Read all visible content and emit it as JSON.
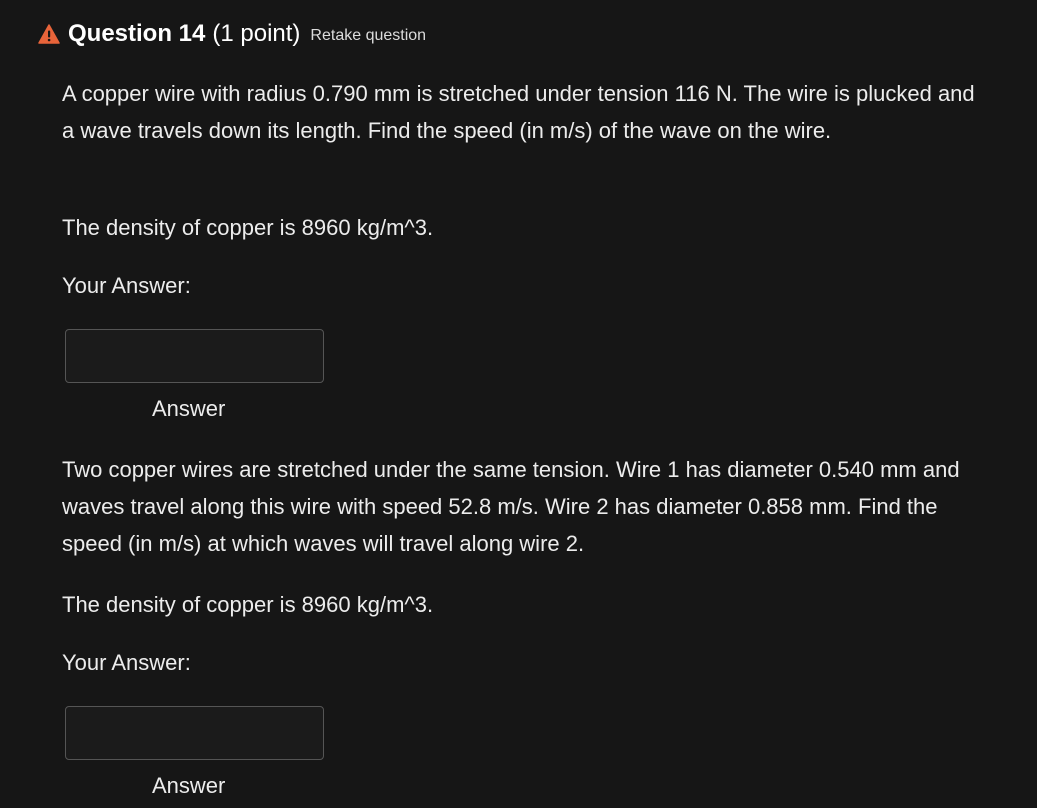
{
  "question": {
    "title": "Question 14",
    "points": "(1 point)",
    "retake_label": "Retake question",
    "warning_color": "#e8643a"
  },
  "parts": [
    {
      "prompt": "A copper wire with radius 0.790 mm is stretched under tension 116 N.  The wire is plucked and a wave travels down its length. Find the speed (in m/s) of the wave on the wire.",
      "density_note": "The density of copper is 8960 kg/m^3.",
      "your_answer_label": "Your Answer:",
      "answer_value": "",
      "answer_caption": "Answer"
    },
    {
      "prompt": "Two copper wires are stretched under the same tension. Wire 1 has diameter 0.540 mm and waves travel along this wire with speed 52.8 m/s. Wire 2 has diameter 0.858 mm. Find the speed (in m/s) at which waves will travel along wire 2.",
      "density_note": "The density of copper is 8960 kg/m^3.",
      "your_answer_label": "Your Answer:",
      "answer_value": "",
      "answer_caption": "Answer"
    }
  ]
}
